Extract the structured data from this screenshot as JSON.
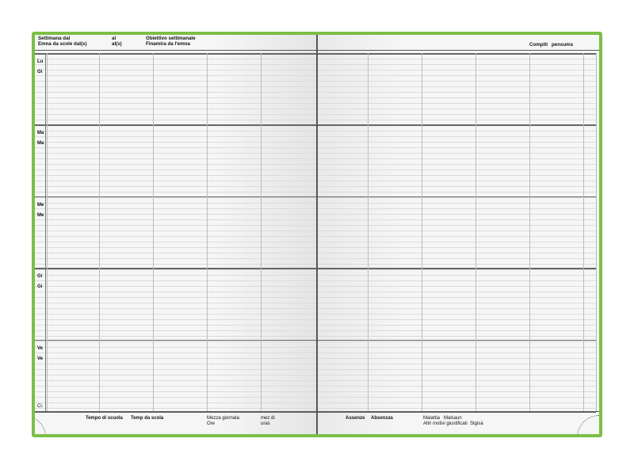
{
  "header": {
    "week_from": "Settimana dal",
    "week_from_rm": "Emna da scole dal(s)",
    "to": "al",
    "to_rm": "al(s)",
    "goal": "Obiettivo settimanale",
    "goal_rm": "Finamira da l'emna",
    "homework": "Compiti",
    "homework_rm": "pensums"
  },
  "days": [
    {
      "it": "Lu",
      "rm": "Gi"
    },
    {
      "it": "Ma",
      "rm": "Ma"
    },
    {
      "it": "Me",
      "rm": "Me"
    },
    {
      "it": "Gi",
      "rm": "Gi"
    },
    {
      "it": "Ve",
      "rm": "Ve"
    }
  ],
  "ci_label": "Ci.",
  "footer_left": {
    "school_time": "Tempo di scuola",
    "school_time_rm": "Temp da scola",
    "half_day": "Mezza giornata",
    "hours": "Ore",
    "half_day_rm": "mez di",
    "hours_rm": "uras"
  },
  "footer_right": {
    "absences": "Assenze",
    "absences_rm": "Absenzas",
    "illness": "Malattia",
    "illness_rm": "Malsaun",
    "other_reasons": "Altri motivi giustificati",
    "other_reasons_rm": "Stgisà"
  },
  "colors": {
    "cover": "#7bbf45",
    "paper": "#f6f6f6",
    "rule": "#dcdcdc",
    "line": "#666666"
  }
}
